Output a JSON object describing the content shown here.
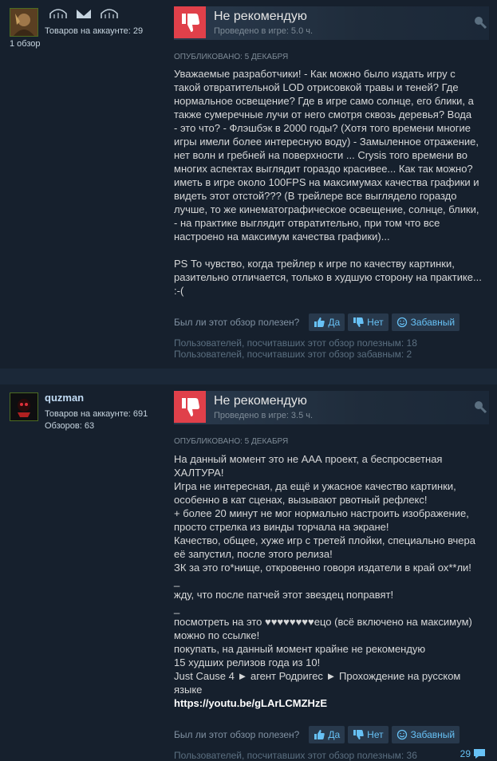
{
  "reviews": [
    {
      "author": "",
      "products_on_account": "Товаров на аккаунте: 29",
      "reviews_count": "1 обзор",
      "vote": "Не рекомендую",
      "hours": "Проведено в игре: 5.0 ч.",
      "posted": "ОПУБЛИКОВАНО: 5 ДЕКАБРЯ",
      "text_lines": [
        "Уважаемые разработчики! - Как можно было издать игру с",
        "такой отвратительной LOD отрисовкой травы и теней? Где",
        "нормальное освещение? Где в игре само солнце, его блики, а",
        "также сумеречные лучи от него смотря сквозь деревья? Вода",
        "- это что? - Флэшбэк в 2000 годы? (Хотя того времени многие",
        "игры имели более интересную воду) - Замыленное отражение,",
        "нет волн и гребней на поверхности ... Crysis того времени во",
        "многих аспектах выглядит гораздо красивее... Как так можно?",
        "иметь в игре около 100FPS на максимумах качества графики и",
        "видеть этот отстой??? (В трейлере все выглядело гораздо",
        "лучше, то же кинематографическое освещение, солнце, блики,",
        "- на практике выглядит отвратительно, при том что все",
        "настроено на максимум качества графики)..."
      ],
      "ps_lines": [
        "PS То чувство, когда трейлер к игре по качеству картинки,",
        "разительно отличается, только в худшую сторону на практике...",
        ":-("
      ],
      "helpful_question": "Был ли этот обзор полезен?",
      "btn_yes": "Да",
      "btn_no": "Нет",
      "btn_funny": "Забавный",
      "stat_helpful": "Пользователей, посчитавших этот обзор полезным: 18",
      "stat_funny": "Пользователей, посчитавших этот обзор забавным: 2"
    },
    {
      "author": "quzman",
      "products_on_account": "Товаров на аккаунте: 691",
      "reviews_count": "Обзоров: 63",
      "vote": "Не рекомендую",
      "hours": "Проведено в игре: 3.5 ч.",
      "posted": "ОПУБЛИКОВАНО: 5 ДЕКАБРЯ",
      "text_lines": [
        "На данный момент это не ААА проект, а беспросветная",
        "ХАЛТУРА!",
        "Игра не интересная, да ещё и ужасное качество картинки,",
        "особенно в кат сценах, вызывают рвотный рефлекс!",
        "+ более 20 минут не мог нормально настроить изображение,",
        "просто стрелка из винды торчала на экране!",
        "Качество, общее, хуже игр с третей плойки, специально вчера",
        "её запустил, после этого релиза!",
        "ЗК за это го*нище, откровенно говоря издатели в край ох**ли!",
        "_",
        "жду, что после патчей этот звездец поправят!",
        "_",
        "посмотреть на это ♥♥♥♥♥♥♥♥ецо (всё включено на максимум)",
        "можно по ссылке!",
        "покупать, на данный момент крайне не рекомендую",
        "15 худших релизов года из 10!",
        "Just Cause 4 ► агент Родригес ► Прохождение на русском",
        "языке"
      ],
      "link": "https://youtu.be/gLArLCMZHzE",
      "helpful_question": "Был ли этот обзор полезен?",
      "btn_yes": "Да",
      "btn_no": "Нет",
      "btn_funny": "Забавный",
      "stat_helpful": "Пользователей, посчитавших этот обзор полезным: 36",
      "comments": "29"
    }
  ],
  "colors": {
    "thumb_down_bg": "#e0404a",
    "link_blue": "#67c1f5",
    "page_bg": "#1b2838",
    "card_bg": "#16202d"
  }
}
